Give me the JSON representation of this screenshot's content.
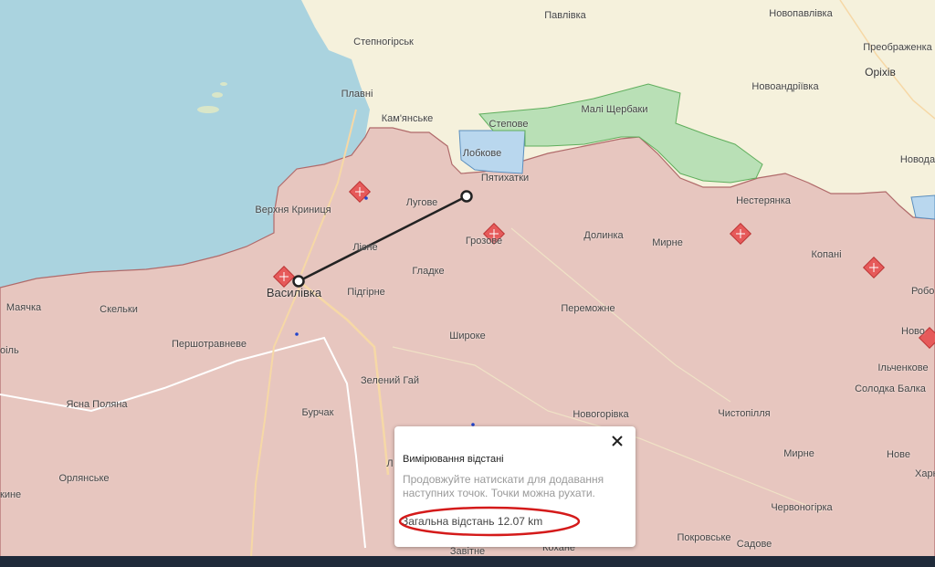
{
  "colors": {
    "water": "#aad3df",
    "land": "#f5f1dc",
    "occupied": "#e7c6bf",
    "occupied_border": "#b06a6a",
    "liberated": "#b9e0b6",
    "liberated_border": "#5fae5c",
    "contested": "#b9d7ee",
    "contested_border": "#5b8fbf",
    "marker": "#e65a5a",
    "ruler_line": "#222222",
    "highlight_circle": "#d41a1a"
  },
  "place_labels": [
    {
      "name": "Павлівка"
    },
    {
      "name": "Новопавлівка"
    },
    {
      "name": "Степногірськ"
    },
    {
      "name": "Преображенка"
    },
    {
      "name": "Оріхів"
    },
    {
      "name": "Плавні"
    },
    {
      "name": "Новоандріївка"
    },
    {
      "name": "Кам'янське"
    },
    {
      "name": "Малі Щербаки"
    },
    {
      "name": "Степове"
    },
    {
      "name": "Лобкове"
    },
    {
      "name": "Пятихатки"
    },
    {
      "name": "Новода"
    },
    {
      "name": "Верхня Криниця"
    },
    {
      "name": "Лугове"
    },
    {
      "name": "Нестерянка"
    },
    {
      "name": "Лісне"
    },
    {
      "name": "Грозове"
    },
    {
      "name": "Долинка"
    },
    {
      "name": "Мирне"
    },
    {
      "name": "Копані"
    },
    {
      "name": "Гладке"
    },
    {
      "name": "Василівка"
    },
    {
      "name": "Підгірне"
    },
    {
      "name": "Маячка"
    },
    {
      "name": "Скельки"
    },
    {
      "name": "Переможне"
    },
    {
      "name": "Робо"
    },
    {
      "name": "Ново"
    },
    {
      "name": "Першотравневе"
    },
    {
      "name": "Широке"
    },
    {
      "name": "Ільченкове"
    },
    {
      "name": "оіль"
    },
    {
      "name": "Зелений Гай"
    },
    {
      "name": "Солодка Балка"
    },
    {
      "name": "Ясна Поляна"
    },
    {
      "name": "Бурчак"
    },
    {
      "name": "Новогорівка"
    },
    {
      "name": "Чистопілля"
    },
    {
      "name": "Мирне"
    },
    {
      "name": "Нове"
    },
    {
      "name": "Харко"
    },
    {
      "name": "Орлянське"
    },
    {
      "name": "кине"
    },
    {
      "name": "Червоногірка"
    },
    {
      "name": "Покровське"
    },
    {
      "name": "Садове"
    },
    {
      "name": "Завітне"
    },
    {
      "name": "Кохане"
    },
    {
      "name": "Л"
    }
  ],
  "measure_popup": {
    "title": "Вимірювання відстані",
    "hint": "Продовжуйте натискати для додавання наступних точок. Точки можна рухати.",
    "total": "Загальна відстань 12.07 km",
    "close_icon": "close-icon"
  },
  "icons": {
    "marker": "explosion-marker-icon",
    "ruler_point": "ruler-point-icon"
  }
}
